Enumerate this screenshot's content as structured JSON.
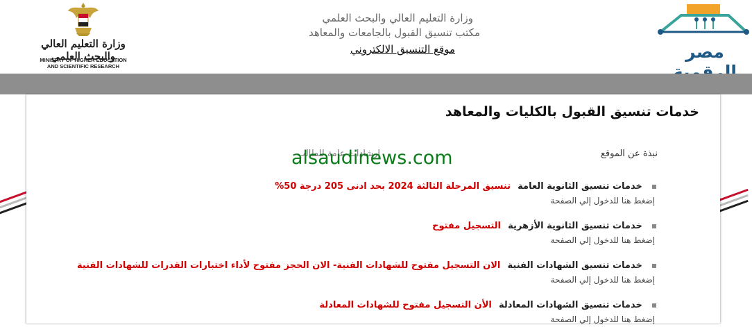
{
  "header": {
    "ministry_ar": "وزارة التعليم العالي والبحث العلمي",
    "ministry_en_line1": "MINISTRY OF HIGHER EDUCATION",
    "ministry_en_line2": "AND SCIENTIFIC RESEARCH",
    "line1": "وزارة التعليم العالي والبحث العلمي",
    "line2": "مكتب تنسيق القبول بالجامعات والمعاهد",
    "line3": "موقع التنسيق الالكتروني",
    "brand": "مصر الرقمية"
  },
  "colors": {
    "nav_bar": "#8e8e8e",
    "alert_red": "#d00000",
    "watermark_green": "#0a7d1a",
    "brand_blue": "#1f5a86",
    "brand_orange": "#f2a32a",
    "brand_teal": "#3aa39b"
  },
  "main": {
    "title": "خدمات تنسيق القبول بالكليات والمعاهد",
    "about_link": "نبذة عن الموقع",
    "guide_link": "إرشادات عامة للطالب",
    "watermark": "alsaudinews.com",
    "services": [
      {
        "title": "خدمات تنسيق الثانوية العامة",
        "note": "تنسيق المرحلة الثالثة 2024 بحد ادنى 205 درجة 50%",
        "sub": "إضغط هنا للدخول إلي الصفحة"
      },
      {
        "title": "خدمات تنسيق الثانوية الأزهرية",
        "note": "التسجيل مفتوح",
        "sub": "إضغط هنا للدخول إلي الصفحة"
      },
      {
        "title": "خدمات تنسيق الشهادات الفنية",
        "note": "الان التسجيل مفتوح للشهادات الفنية- الان الحجز مفتوح لأداء اختبارات القدرات للشهادات الفنية",
        "sub": "إضغط هنا للدخول إلي الصفحة"
      },
      {
        "title": "خدمات تنسيق الشهادات المعادلة",
        "note": "الأن التسجيل مفتوح للشهادات المعادلة",
        "sub": "إضغط هنا للدخول إلي الصفحة"
      }
    ]
  }
}
